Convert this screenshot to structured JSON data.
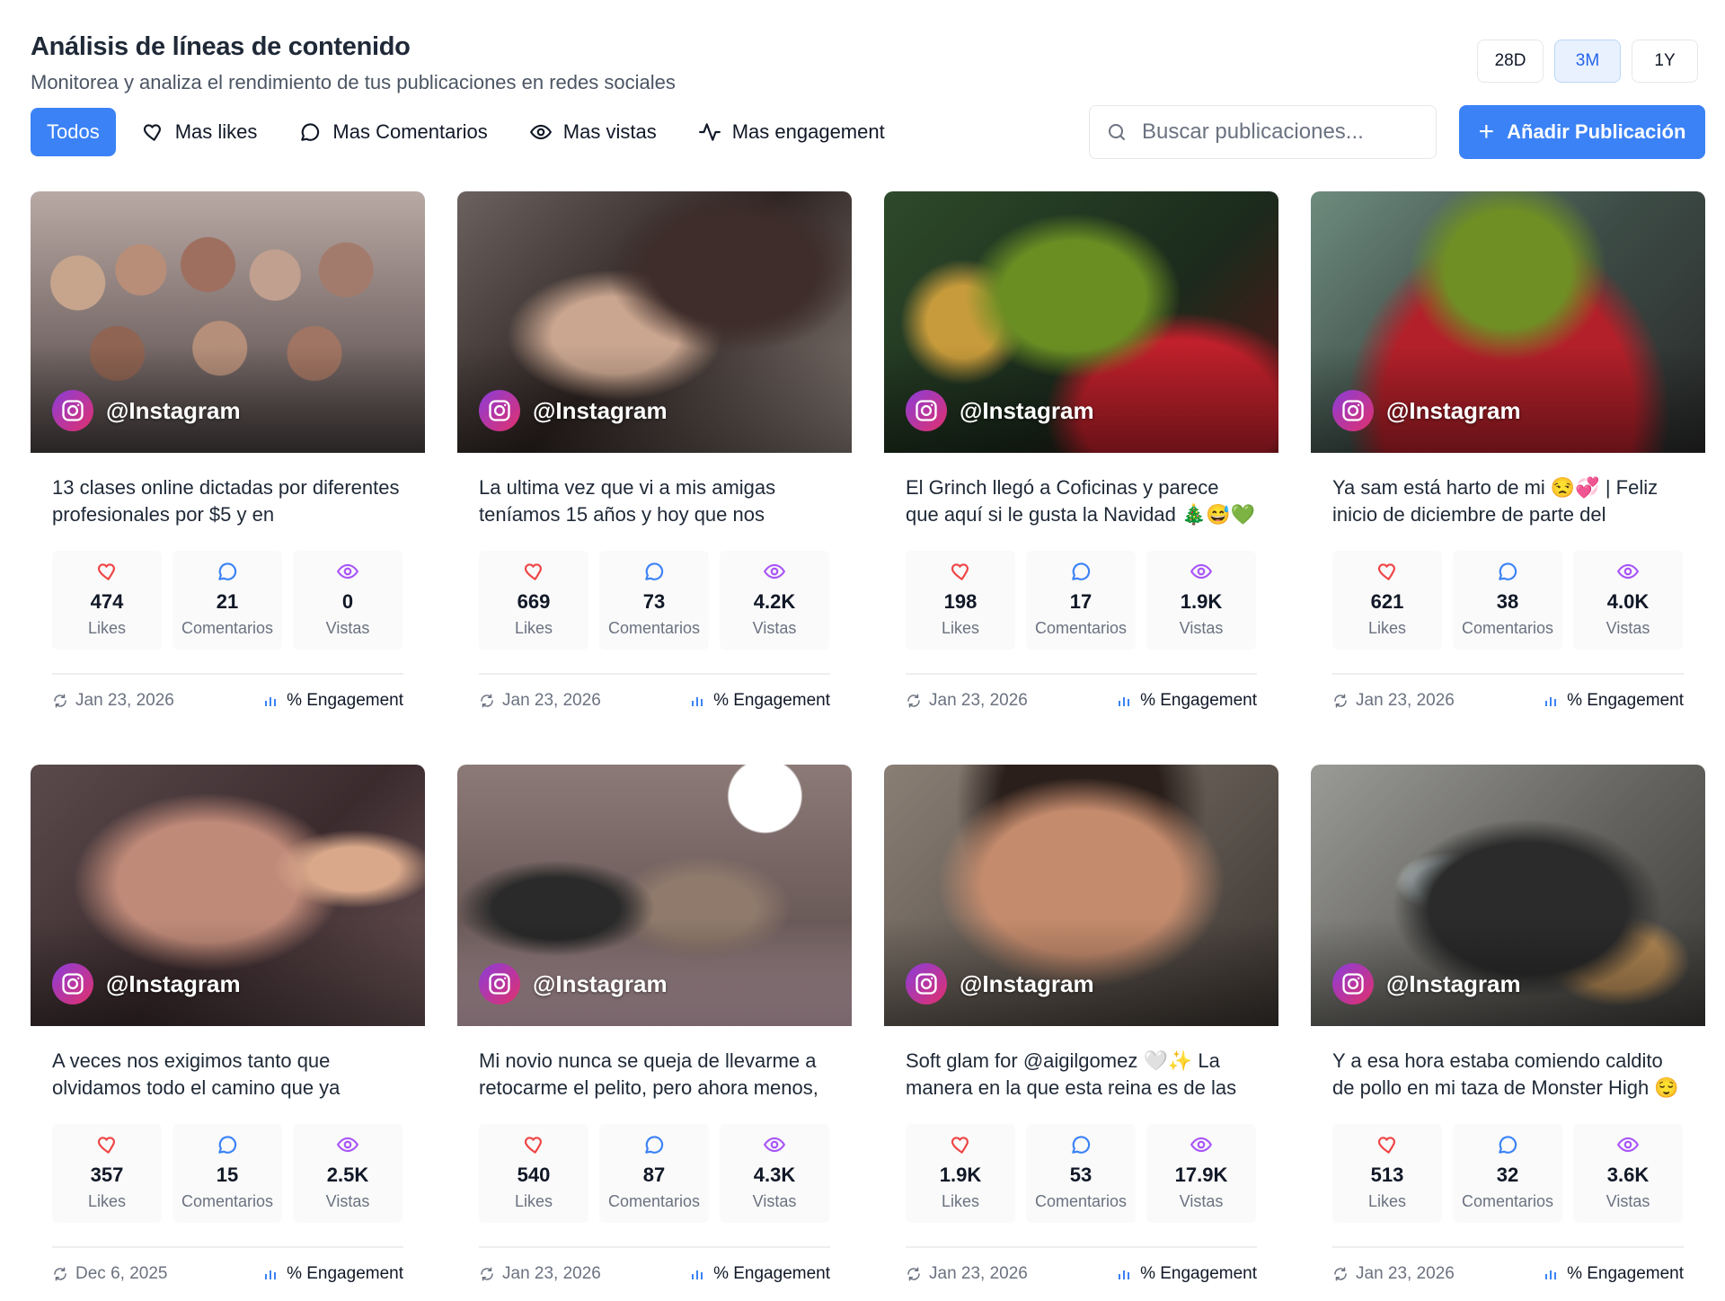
{
  "header": {
    "title": "Análisis de líneas de contenido",
    "subtitle": "Monitorea y analiza el rendimiento de tus publicaciones en redes sociales"
  },
  "periods": [
    {
      "label": "28D",
      "active": false
    },
    {
      "label": "3M",
      "active": true
    },
    {
      "label": "1Y",
      "active": false
    }
  ],
  "filters": [
    {
      "label": "Todos",
      "icon": "none",
      "active": true
    },
    {
      "label": "Mas likes",
      "icon": "heart-icon",
      "active": false
    },
    {
      "label": "Mas Comentarios",
      "icon": "comment-icon",
      "active": false
    },
    {
      "label": "Mas vistas",
      "icon": "eye-icon",
      "active": false
    },
    {
      "label": "Mas engagement",
      "icon": "activity-icon",
      "active": false
    }
  ],
  "search": {
    "placeholder": "Buscar publicaciones..."
  },
  "add_button": {
    "label": "Añadir Publicación"
  },
  "colors": {
    "accent": "#3b82f6",
    "likes": "#ef4444",
    "comments": "#3b82f6",
    "views": "#a855f7"
  },
  "posts": [
    {
      "handle": "@Instagram",
      "caption": "13 clases online dictadas por diferentes profesionales por $5 y en",
      "likes": "474",
      "likes_label": "Likes",
      "comments": "21",
      "comments_label": "Comentarios",
      "views": "0",
      "views_label": "Vistas",
      "date": "Jan 23, 2026",
      "engagement": "% Engagement"
    },
    {
      "handle": "@Instagram",
      "caption": "La ultima vez que vi a mis amigas teníamos 15 años y hoy que nos",
      "likes": "669",
      "likes_label": "Likes",
      "comments": "73",
      "comments_label": "Comentarios",
      "views": "4.2K",
      "views_label": "Vistas",
      "date": "Jan 23, 2026",
      "engagement": "% Engagement"
    },
    {
      "handle": "@Instagram",
      "caption": "El Grinch llegó a Coficinas y parece que aquí si le gusta la Navidad 🎄😅💚",
      "likes": "198",
      "likes_label": "Likes",
      "comments": "17",
      "comments_label": "Comentarios",
      "views": "1.9K",
      "views_label": "Vistas",
      "date": "Jan 23, 2026",
      "engagement": "% Engagement"
    },
    {
      "handle": "@Instagram",
      "caption": "Ya sam está harto de mi 😒💞 | Feliz inicio de diciembre de parte del",
      "likes": "621",
      "likes_label": "Likes",
      "comments": "38",
      "comments_label": "Comentarios",
      "views": "4.0K",
      "views_label": "Vistas",
      "date": "Jan 23, 2026",
      "engagement": "% Engagement"
    },
    {
      "handle": "@Instagram",
      "caption": "A veces nos exigimos tanto que olvidamos todo el camino que ya",
      "likes": "357",
      "likes_label": "Likes",
      "comments": "15",
      "comments_label": "Comentarios",
      "views": "2.5K",
      "views_label": "Vistas",
      "date": "Dec 6, 2025",
      "engagement": "% Engagement"
    },
    {
      "handle": "@Instagram",
      "caption": "Mi novio nunca se queja de llevarme a retocarme el pelito, pero ahora menos,",
      "likes": "540",
      "likes_label": "Likes",
      "comments": "87",
      "comments_label": "Comentarios",
      "views": "4.3K",
      "views_label": "Vistas",
      "date": "Jan 23, 2026",
      "engagement": "% Engagement"
    },
    {
      "handle": "@Instagram",
      "caption": "Soft glam for @aigilgomez 🤍✨ La manera en la que esta reina es de las",
      "likes": "1.9K",
      "likes_label": "Likes",
      "comments": "53",
      "comments_label": "Comentarios",
      "views": "17.9K",
      "views_label": "Vistas",
      "date": "Jan 23, 2026",
      "engagement": "% Engagement"
    },
    {
      "handle": "@Instagram",
      "caption": "Y a esa hora estaba comiendo caldito de pollo en mi taza de Monster High 😌",
      "likes": "513",
      "likes_label": "Likes",
      "comments": "32",
      "comments_label": "Comentarios",
      "views": "3.6K",
      "views_label": "Vistas",
      "date": "Jan 23, 2026",
      "engagement": "% Engagement"
    }
  ]
}
